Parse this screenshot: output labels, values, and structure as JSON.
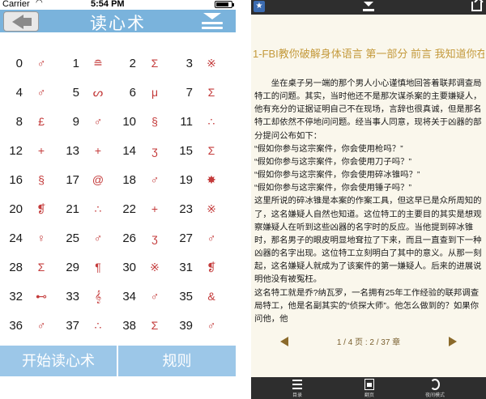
{
  "left": {
    "status": {
      "carrier": "Carrier",
      "time": "5:54 PM",
      "battery_level": 0.85
    },
    "nav": {
      "title": "读心术"
    },
    "grid": [
      [
        [
          "0",
          "♂"
        ],
        [
          "1",
          "≘"
        ],
        [
          "2",
          "Σ"
        ],
        [
          "3",
          "※"
        ]
      ],
      [
        [
          "4",
          "♂"
        ],
        [
          "5",
          "ᔕ"
        ],
        [
          "6",
          "μ"
        ],
        [
          "7",
          "Σ"
        ]
      ],
      [
        [
          "8",
          "£"
        ],
        [
          "9",
          "♂"
        ],
        [
          "10",
          "§"
        ],
        [
          "11",
          "∴"
        ]
      ],
      [
        [
          "12",
          "+"
        ],
        [
          "13",
          "+"
        ],
        [
          "14",
          "ʒ"
        ],
        [
          "15",
          "Σ"
        ]
      ],
      [
        [
          "16",
          "§"
        ],
        [
          "17",
          "@"
        ],
        [
          "18",
          "♂"
        ],
        [
          "19",
          "✸"
        ]
      ],
      [
        [
          "20",
          "❡"
        ],
        [
          "21",
          "∴"
        ],
        [
          "22",
          "+"
        ],
        [
          "23",
          "※"
        ]
      ],
      [
        [
          "24",
          "♀"
        ],
        [
          "25",
          "♂"
        ],
        [
          "26",
          "ʒ"
        ],
        [
          "27",
          "♂"
        ]
      ],
      [
        [
          "28",
          "Σ"
        ],
        [
          "29",
          "¶"
        ],
        [
          "30",
          "※"
        ],
        [
          "31",
          "❡"
        ]
      ],
      [
        [
          "32",
          "⊷"
        ],
        [
          "33",
          "𝄞"
        ],
        [
          "34",
          "♂"
        ],
        [
          "35",
          "&"
        ]
      ],
      [
        [
          "36",
          "♂"
        ],
        [
          "37",
          "∴"
        ],
        [
          "38",
          "Σ"
        ],
        [
          "39",
          "♂"
        ]
      ]
    ],
    "footer": {
      "start_label": "开始读心术",
      "rule_label": "规则"
    },
    "colors": {
      "nav_bg": "#7ab3dc",
      "footer_bg": "#9cc7e8",
      "symbol": "#c43b3b"
    }
  },
  "right": {
    "chapter_title": "1-FBI教你破解身体语言 第一部分 前言 我知道你在想什么",
    "paragraphs": [
      {
        "type": "para",
        "text": "坐在桌子另一端的那个男人小心谨慎地回答着联邦调查局特工的问题。其实，当时他还不是那次谋杀案的主要嫌疑人，他有充分的证据证明自己不在现场，言辞也很真诚，但是那名特工却依然不停地问问题。经当事人同意，现将关于凶器的部分提问公布如下："
      },
      {
        "type": "quote",
        "text": "“假如你参与这宗案件，你会使用枪吗？”"
      },
      {
        "type": "quote",
        "text": "“假如你参与这宗案件，你会使用刀子吗？”"
      },
      {
        "type": "quote",
        "text": "“假如你参与这宗案件，你会使用碎冰锥吗？”"
      },
      {
        "type": "quote",
        "text": "“假如你参与这宗案件，你会使用锤子吗？”"
      },
      {
        "type": "cont",
        "text": "这里所说的碎冰锥是本案的作案工具，但这早已是众所周知的了，这名嫌疑人自然也知道。这位特工的主要目的其实是想观察嫌疑人在听到这些凶器的名字时的反应。当他提到碎冰锥时，那名男子的眼皮明显地耷拉了下来，而且一直查到下一种凶器的名字出现。这位特工立刻明白了其中的意义。从那一刻起，这名嫌疑人就成为了该案件的第一嫌疑人。后来的进展说明他没有被冤枉。"
      },
      {
        "type": "cont",
        "text": "这名特工就是乔?纳瓦罗，一名拥有25年工作经验的联邦调查局特工，他是名副其实的“侦探大师”。他怎么做到的？如果你问他，他"
      }
    ],
    "pager": {
      "info": "1 / 4 页 : 2 / 37 章"
    },
    "toolbar": [
      {
        "icon": "list-icon",
        "label": "目录"
      },
      {
        "icon": "page-icon",
        "label": "翻页"
      },
      {
        "icon": "moon-icon",
        "label": "夜间模式"
      }
    ],
    "colors": {
      "title": "#c49a3c",
      "bar_bg": "#2e2e2e",
      "arrow": "#8b6a2a"
    }
  }
}
